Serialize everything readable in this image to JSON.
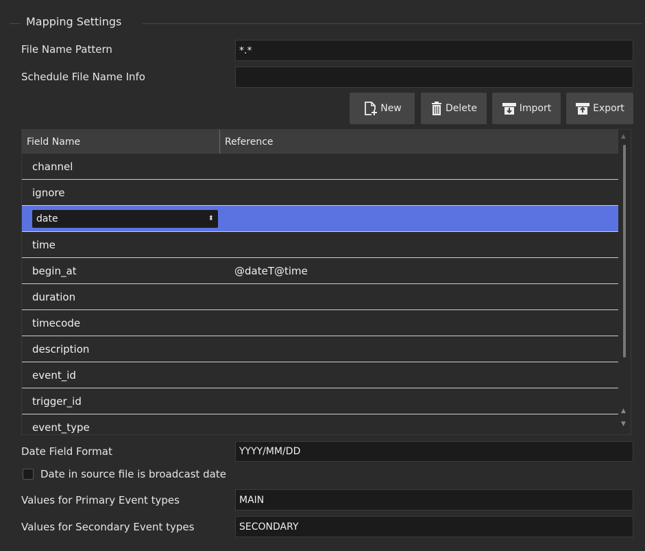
{
  "group": {
    "title": "Mapping Settings"
  },
  "file_name_pattern": {
    "label": "File Name Pattern",
    "value": "*.*"
  },
  "schedule_file_name_info": {
    "label": "Schedule File Name Info",
    "value": ""
  },
  "toolbar": {
    "new_label": "New",
    "delete_label": "Delete",
    "import_label": "Import",
    "export_label": "Export"
  },
  "table": {
    "columns": [
      "Field Name",
      "Reference"
    ],
    "rows": [
      {
        "field": "channel",
        "reference": ""
      },
      {
        "field": "ignore",
        "reference": ""
      },
      {
        "field": "date",
        "reference": "",
        "selected": true
      },
      {
        "field": "time",
        "reference": ""
      },
      {
        "field": "begin_at",
        "reference": "@dateT@time"
      },
      {
        "field": "duration",
        "reference": ""
      },
      {
        "field": "timecode",
        "reference": ""
      },
      {
        "field": "description",
        "reference": ""
      },
      {
        "field": "event_id",
        "reference": ""
      },
      {
        "field": "trigger_id",
        "reference": ""
      },
      {
        "field": "event_type",
        "reference": ""
      }
    ]
  },
  "date_field_format": {
    "label": "Date Field Format",
    "value": "YYYY/MM/DD"
  },
  "broadcast_date_checkbox": {
    "label": "Date in source file is broadcast date",
    "checked": false
  },
  "primary_event_types": {
    "label": "Values for Primary Event types",
    "value": "MAIN"
  },
  "secondary_event_types": {
    "label": "Values for Secondary Event types",
    "value": "SECONDARY"
  },
  "colors": {
    "background": "#2b2b2b",
    "selection": "#5b73e0",
    "field_bg": "#1b1b1b",
    "button_bg": "#454545"
  }
}
